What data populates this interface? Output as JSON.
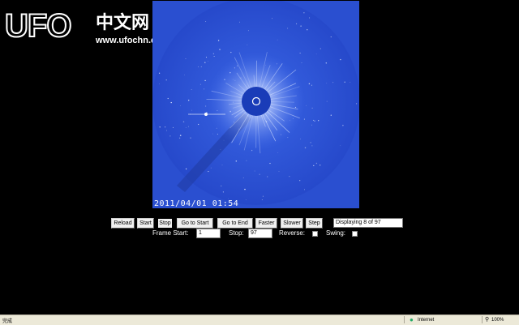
{
  "logo": {
    "ufo_text": "UFO",
    "cn_text": "中文网",
    "url_text": "www.ufochn.com"
  },
  "image": {
    "timestamp": "2011/04/01  01:54",
    "background_color": "#2a4fd0"
  },
  "controls": {
    "buttons": [
      "Reload",
      "Start",
      "Stop",
      "Go to Start",
      "Go to End",
      "Faster",
      "Slower",
      "Step"
    ],
    "display_status": "Displaying 8 of 97",
    "frame_start_label": "Frame Start:",
    "frame_start_value": "1",
    "stop_label": "Stop:",
    "stop_value": "97",
    "reverse_label": "Reverse:",
    "swing_label": "Swing:"
  },
  "statusbar": {
    "left_text": "完成",
    "network_text": "Internet",
    "zoom_text": "100%"
  }
}
